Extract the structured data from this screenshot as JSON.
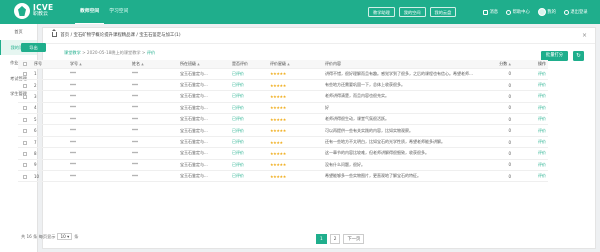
{
  "brand": {
    "name": "ICVE",
    "sub": "职教云"
  },
  "nav": [
    "教师空间",
    "学习空间"
  ],
  "top_buttons": [
    "教学助理",
    "我的空间",
    "我的云盘"
  ],
  "header_utils": {
    "messages": "消息",
    "help": "帮助中心",
    "user": "我的",
    "logout": "退出登录"
  },
  "sidebar": [
    "首页",
    "我的课程",
    "作业管理",
    "考试管理",
    "学生管理"
  ],
  "breadcrumb": "首页 / 宝石矿物学概论提升课程精品课 / 宝玉石鉴定与加工(1)",
  "subpath": {
    "prefix": "课堂教学",
    "text": " > 2020-05-18晚上的课堂教学 > ",
    "current": "评价"
  },
  "buttons": {
    "batch": "批量打分",
    "refresh": "↻",
    "export": "导出"
  },
  "table": {
    "headers": [
      "序号",
      "学号",
      "姓名",
      "所在班级",
      "是否评价",
      "评价星级",
      "评价内容",
      "分数",
      "操作"
    ],
    "rows": [
      {
        "no": "1",
        "id": "***",
        "name": "***",
        "class": "宝玉石鉴定与...",
        "status": "已评价",
        "stars": 5,
        "content": "讲得不错，很好理解而且有趣。感觉学到了很多，之后的课程也有信心。希望老师继续这样讲。",
        "score": "0",
        "action": "评价"
      },
      {
        "no": "2",
        "id": "***",
        "name": "***",
        "class": "宝玉石鉴定与...",
        "status": "已评价",
        "stars": 5,
        "content": "有些地方还需要巩固一下，总体上收获很多。",
        "score": "0",
        "action": "评价"
      },
      {
        "no": "3",
        "id": "***",
        "name": "***",
        "class": "宝玉石鉴定与...",
        "status": "已评价",
        "stars": 5,
        "content": "老师讲得清楚，而且内容也很充实。",
        "score": "0",
        "action": "评价"
      },
      {
        "no": "4",
        "id": "***",
        "name": "***",
        "class": "宝玉石鉴定与...",
        "status": "已评价",
        "stars": 5,
        "content": "好",
        "score": "0",
        "action": "评价"
      },
      {
        "no": "5",
        "id": "***",
        "name": "***",
        "class": "宝玉石鉴定与...",
        "status": "已评价",
        "stars": 5,
        "content": "老师讲得很生动，课堂气氛很活跃。",
        "score": "0",
        "action": "评价"
      },
      {
        "no": "6",
        "id": "***",
        "name": "***",
        "class": "宝玉石鉴定与...",
        "status": "已评价",
        "stars": 5,
        "content": "可以再提供一些有关实践的内容，比如实物观察。",
        "score": "0",
        "action": "评价"
      },
      {
        "no": "7",
        "id": "***",
        "name": "***",
        "class": "宝玉石鉴定与...",
        "status": "已评价",
        "stars": 4,
        "content": "还有一些地方不太明白，比如宝石的光学性质，希望老师能多讲解。",
        "score": "0",
        "action": "评价"
      },
      {
        "no": "8",
        "id": "***",
        "name": "***",
        "class": "宝玉石鉴定与...",
        "status": "已评价",
        "stars": 5,
        "content": "这一章节的内容比较难，但老师讲解得很细致，收获很多。",
        "score": "0",
        "action": "评价"
      },
      {
        "no": "9",
        "id": "***",
        "name": "***",
        "class": "宝玉石鉴定与...",
        "status": "已评价",
        "stars": 5,
        "content": "没有什么问题，很好。",
        "score": "0",
        "action": "评价"
      },
      {
        "no": "10",
        "id": "***",
        "name": "***",
        "class": "宝玉石鉴定与...",
        "status": "已评价",
        "stars": 5,
        "content": "希望能够多一些实物图片，更直观地了解宝石的特征。",
        "score": "0",
        "action": "评价"
      }
    ]
  },
  "footer": {
    "total": "共 16 条 每页显示",
    "page_size": "10",
    "unit": "条"
  },
  "pager": {
    "p1": "1",
    "p2": "2",
    "next": "下一页"
  },
  "colors": {
    "accent": "#1fae8c",
    "star": "#f0ad1c"
  }
}
